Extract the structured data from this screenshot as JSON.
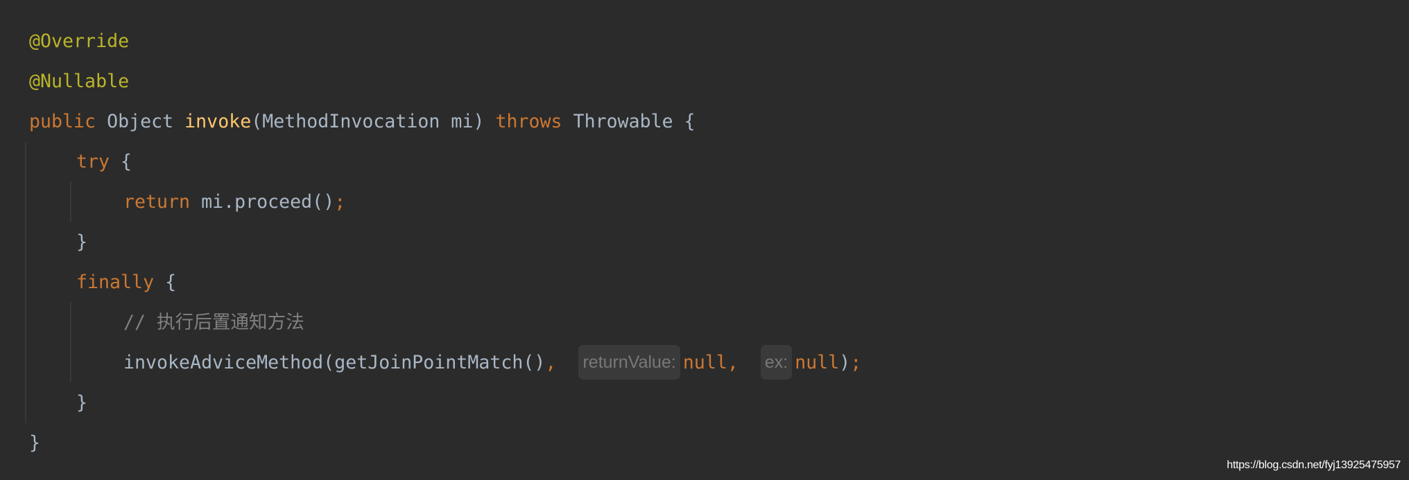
{
  "editor": {
    "colors": {
      "background": "#2b2b2b",
      "annotation": "#bbb529",
      "keyword": "#cc7832",
      "text": "#a9b7c6",
      "method_declaration": "#ffc66d",
      "comment": "#808080",
      "inlay_hint": "#787878"
    },
    "lines": [
      {
        "indent": 0,
        "tokens": [
          {
            "t": "@Override",
            "k": "ann"
          }
        ]
      },
      {
        "indent": 0,
        "tokens": [
          {
            "t": "@Nullable",
            "k": "ann"
          }
        ]
      },
      {
        "indent": 0,
        "tokens": [
          {
            "t": "public ",
            "k": "kw"
          },
          {
            "t": "Object ",
            "k": "txt"
          },
          {
            "t": "invoke",
            "k": "decl"
          },
          {
            "t": "(MethodInvocation mi) ",
            "k": "txt"
          },
          {
            "t": "throws ",
            "k": "kw"
          },
          {
            "t": "Throwable {",
            "k": "txt"
          }
        ]
      },
      {
        "indent": 1,
        "tokens": [
          {
            "t": "try ",
            "k": "kw"
          },
          {
            "t": "{",
            "k": "txt"
          }
        ]
      },
      {
        "indent": 2,
        "tokens": [
          {
            "t": "return ",
            "k": "kw"
          },
          {
            "t": "mi.proceed()",
            "k": "txt"
          },
          {
            "t": ";",
            "k": "kw"
          }
        ]
      },
      {
        "indent": 1,
        "tokens": [
          {
            "t": "}",
            "k": "txt"
          }
        ]
      },
      {
        "indent": 1,
        "tokens": [
          {
            "t": "finally ",
            "k": "kw"
          },
          {
            "t": "{",
            "k": "txt"
          }
        ]
      },
      {
        "indent": 2,
        "tokens": [
          {
            "t": "// 执行后置通知方法",
            "k": "cmt"
          }
        ]
      },
      {
        "indent": 2,
        "tokens": [
          {
            "t": "invokeAdviceMethod(getJoinPointMatch()",
            "k": "txt"
          },
          {
            "t": ",  ",
            "k": "kw"
          },
          {
            "t": "returnValue:",
            "k": "hint"
          },
          {
            "t": "null,  ",
            "k": "kw"
          },
          {
            "t": "ex:",
            "k": "hint"
          },
          {
            "t": "null",
            "k": "kw"
          },
          {
            "t": ")",
            "k": "txt"
          },
          {
            "t": ";",
            "k": "kw"
          }
        ]
      },
      {
        "indent": 1,
        "tokens": [
          {
            "t": "}",
            "k": "txt"
          }
        ]
      },
      {
        "indent": 0,
        "tokens": [
          {
            "t": "}",
            "k": "txt"
          }
        ]
      }
    ]
  },
  "watermark": "https://blog.csdn.net/fyj13925475957"
}
